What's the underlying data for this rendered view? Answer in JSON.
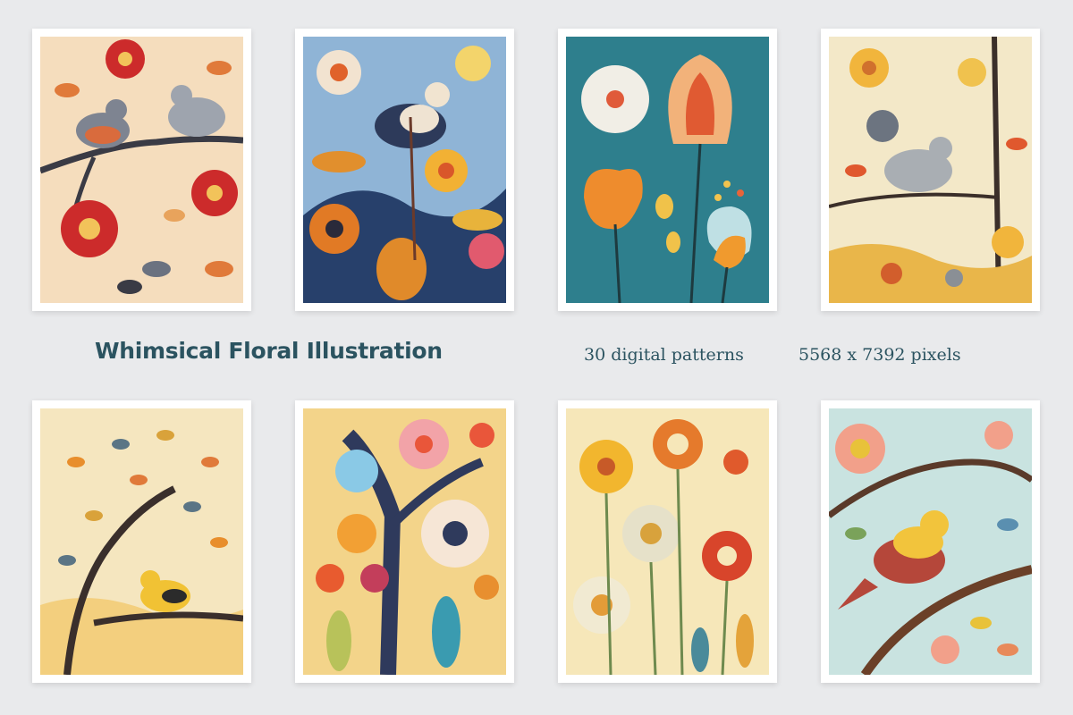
{
  "header": {
    "title": "Whimsical Floral Illustration",
    "count_text": "30 digital patterns",
    "size_text": "5568 x 7392 pixels"
  },
  "prints": [
    {
      "name": "birds-red-flowers"
    },
    {
      "name": "bird-blue-garden"
    },
    {
      "name": "teal-tulips"
    },
    {
      "name": "grey-bird-tree"
    },
    {
      "name": "yellow-bird-tree"
    },
    {
      "name": "tree-flower-garden"
    },
    {
      "name": "yellow-wildflowers"
    },
    {
      "name": "bird-pink-flowers"
    }
  ]
}
